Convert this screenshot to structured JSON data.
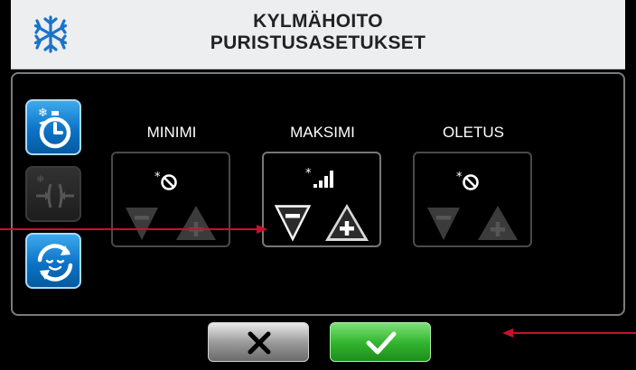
{
  "header": {
    "title_line1": "KYLMÄHOITO",
    "title_line2": "PURISTUSASETUKSET",
    "icon": "snowflake-icon"
  },
  "sidebar": [
    {
      "name": "timer-button",
      "icon": "stopwatch-icon",
      "state": "active"
    },
    {
      "name": "compression-button",
      "icon": "compression-arrows-icon",
      "state": "disabled"
    },
    {
      "name": "relax-cycle-button",
      "icon": "relax-cycle-icon",
      "state": "active"
    }
  ],
  "columns": [
    {
      "label": "MINIMI",
      "level_icon": "no-compression-icon",
      "enabled": false
    },
    {
      "label": "MAKSIMI",
      "level_icon": "signal-bars-icon",
      "enabled": true
    },
    {
      "label": "OLETUS",
      "level_icon": "no-compression-icon",
      "enabled": false
    }
  ],
  "footer": {
    "cancel_icon": "x-icon",
    "confirm_icon": "checkmark-icon"
  },
  "colors": {
    "header_bg": "#eceef0",
    "accent_blue": "#0c73c7",
    "confirm_green": "#34b730",
    "annotation_red": "#c8102e"
  }
}
